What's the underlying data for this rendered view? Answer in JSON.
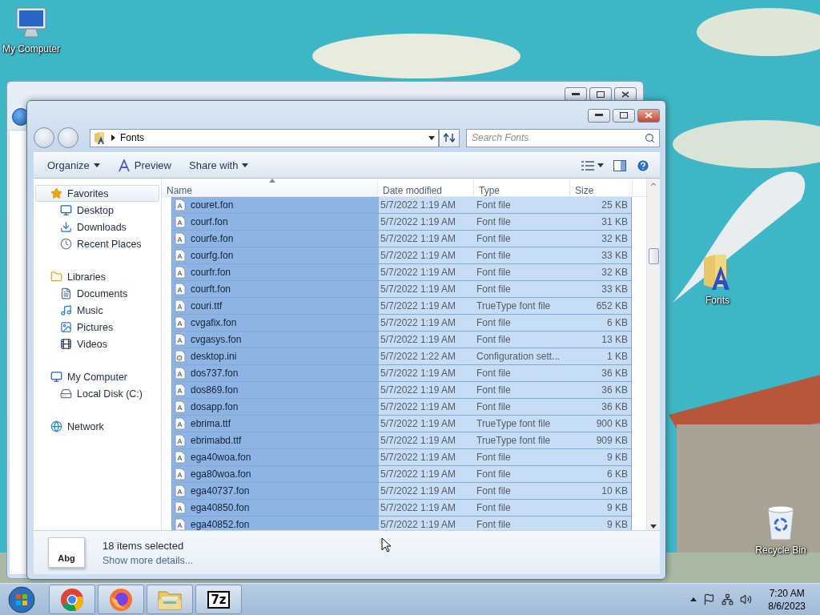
{
  "desktop": {
    "icons": [
      {
        "label": "My Computer",
        "kind": "computer"
      },
      {
        "label": "Fonts",
        "kind": "fonts-folder"
      },
      {
        "label": "Recycle Bin",
        "kind": "recycle-bin"
      }
    ]
  },
  "window": {
    "address": {
      "path": [
        "Fonts"
      ]
    },
    "search": {
      "placeholder": "Search Fonts"
    },
    "toolbar": [
      {
        "label": "Organize",
        "kind": "menu"
      },
      {
        "label": "Preview",
        "kind": "preview"
      },
      {
        "label": "Share with",
        "kind": "menu"
      }
    ],
    "sidebar": {
      "groups": [
        {
          "label": "Favorites",
          "kind": "favorites",
          "selected": true,
          "children": [
            {
              "label": "Desktop",
              "kind": "desktop",
              "selected": false
            },
            {
              "label": "Downloads",
              "kind": "downloads",
              "selected": false
            },
            {
              "label": "Recent Places",
              "kind": "recent",
              "selected": false
            }
          ]
        },
        {
          "label": "Libraries",
          "kind": "libraries",
          "selected": false,
          "children": [
            {
              "label": "Documents",
              "kind": "documents",
              "selected": false
            },
            {
              "label": "Music",
              "kind": "music",
              "selected": false
            },
            {
              "label": "Pictures",
              "kind": "pictures",
              "selected": false
            },
            {
              "label": "Videos",
              "kind": "videos",
              "selected": false
            }
          ]
        },
        {
          "label": "My Computer",
          "kind": "computer",
          "selected": false,
          "children": [
            {
              "label": "Local Disk (C:)",
              "kind": "disk",
              "selected": false
            }
          ]
        },
        {
          "label": "Network",
          "kind": "network",
          "selected": false
        }
      ]
    },
    "table": {
      "columns": [
        {
          "label": "Name",
          "sorted": true
        },
        {
          "label": "Date modified",
          "sorted": false
        },
        {
          "label": "Type",
          "sorted": false
        },
        {
          "label": "Size",
          "sorted": false
        }
      ],
      "rows": [
        {
          "name": "couret.fon",
          "date": "5/7/2022 1:19 AM",
          "type": "Font file",
          "size": "25 KB",
          "kind": "font",
          "selected": true
        },
        {
          "name": "courf.fon",
          "date": "5/7/2022 1:19 AM",
          "type": "Font file",
          "size": "31 KB",
          "kind": "font",
          "selected": true
        },
        {
          "name": "courfe.fon",
          "date": "5/7/2022 1:19 AM",
          "type": "Font file",
          "size": "32 KB",
          "kind": "font",
          "selected": true
        },
        {
          "name": "courfg.fon",
          "date": "5/7/2022 1:19 AM",
          "type": "Font file",
          "size": "33 KB",
          "kind": "font",
          "selected": true
        },
        {
          "name": "courfr.fon",
          "date": "5/7/2022 1:19 AM",
          "type": "Font file",
          "size": "32 KB",
          "kind": "font",
          "selected": true
        },
        {
          "name": "courft.fon",
          "date": "5/7/2022 1:19 AM",
          "type": "Font file",
          "size": "33 KB",
          "kind": "font",
          "selected": true
        },
        {
          "name": "couri.ttf",
          "date": "5/7/2022 1:19 AM",
          "type": "TrueType font file",
          "size": "652 KB",
          "kind": "font",
          "selected": true
        },
        {
          "name": "cvgafix.fon",
          "date": "5/7/2022 1:19 AM",
          "type": "Font file",
          "size": "6 KB",
          "kind": "font",
          "selected": true
        },
        {
          "name": "cvgasys.fon",
          "date": "5/7/2022 1:19 AM",
          "type": "Font file",
          "size": "13 KB",
          "kind": "font",
          "selected": true
        },
        {
          "name": "desktop.ini",
          "date": "5/7/2022 1:22 AM",
          "type": "Configuration sett...",
          "size": "1 KB",
          "kind": "settings",
          "selected": true
        },
        {
          "name": "dos737.fon",
          "date": "5/7/2022 1:19 AM",
          "type": "Font file",
          "size": "36 KB",
          "kind": "font",
          "selected": true
        },
        {
          "name": "dos869.fon",
          "date": "5/7/2022 1:19 AM",
          "type": "Font file",
          "size": "36 KB",
          "kind": "font",
          "selected": true
        },
        {
          "name": "dosapp.fon",
          "date": "5/7/2022 1:19 AM",
          "type": "Font file",
          "size": "36 KB",
          "kind": "font",
          "selected": true
        },
        {
          "name": "ebrima.ttf",
          "date": "5/7/2022 1:19 AM",
          "type": "TrueType font file",
          "size": "900 KB",
          "kind": "font",
          "selected": true
        },
        {
          "name": "ebrimabd.ttf",
          "date": "5/7/2022 1:19 AM",
          "type": "TrueType font file",
          "size": "909 KB",
          "kind": "font",
          "selected": true
        },
        {
          "name": "ega40woa.fon",
          "date": "5/7/2022 1:19 AM",
          "type": "Font file",
          "size": "9 KB",
          "kind": "font",
          "selected": true
        },
        {
          "name": "ega80woa.fon",
          "date": "5/7/2022 1:19 AM",
          "type": "Font file",
          "size": "6 KB",
          "kind": "font",
          "selected": true
        },
        {
          "name": "ega40737.fon",
          "date": "5/7/2022 1:19 AM",
          "type": "Font file",
          "size": "10 KB",
          "kind": "font",
          "selected": true
        },
        {
          "name": "ega40850.fon",
          "date": "5/7/2022 1:19 AM",
          "type": "Font file",
          "size": "9 KB",
          "kind": "font",
          "selected": true
        },
        {
          "name": "ega40852.fon",
          "date": "5/7/2022 1:19 AM",
          "type": "Font file",
          "size": "9 KB",
          "kind": "font",
          "selected": true
        }
      ]
    },
    "details": {
      "preview_label": "Abg",
      "summary": "18 items selected",
      "link": "Show more details..."
    }
  },
  "taskbar": {
    "apps": [
      {
        "kind": "chrome"
      },
      {
        "kind": "firefox"
      },
      {
        "kind": "explorer"
      },
      {
        "kind": "sevenzip",
        "label": "7z"
      }
    ],
    "clock": {
      "time": "7:20 AM",
      "date": "8/6/2023"
    }
  }
}
